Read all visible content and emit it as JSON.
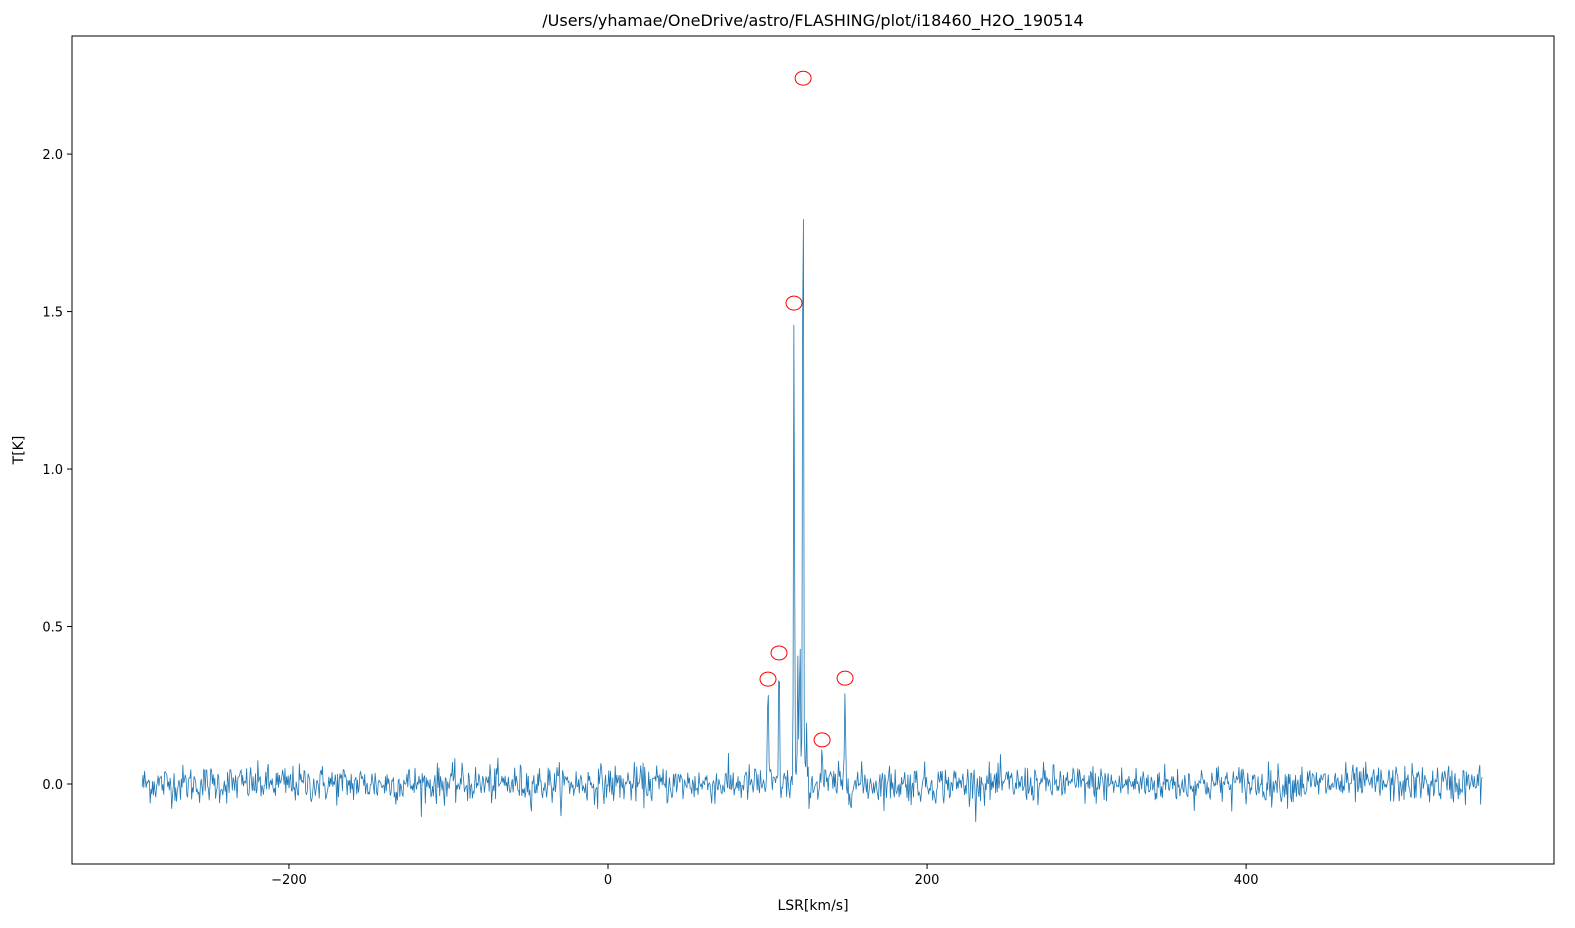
{
  "chart_data": {
    "type": "line",
    "title": "/Users/yhamae/OneDrive/astro/FLASHING/plot/i18460_H2O_190514",
    "xlabel": "LSR[km/s]",
    "ylabel": "T[K]",
    "xlim": [
      -336,
      593
    ],
    "ylim": [
      -0.254,
      2.375
    ],
    "xticks": [
      -200,
      0,
      200,
      400
    ],
    "xtick_labels": [
      "−200",
      "0",
      "200",
      "400"
    ],
    "yticks": [
      0.0,
      0.5,
      1.0,
      1.5,
      2.0
    ],
    "ytick_labels": [
      "0.0",
      "0.5",
      "1.0",
      "1.5",
      "2.0"
    ],
    "grid": false,
    "line_color": "#1f77b4",
    "marker_color": "#ff0000",
    "spectrum": {
      "x_range": [
        -292,
        548
      ],
      "channel_width": 0.5,
      "noise_rms": 0.03,
      "baseline": 0.0,
      "lines": [
        {
          "x": 100.3,
          "y": 0.333
        },
        {
          "x": 107.2,
          "y": 0.416
        },
        {
          "x": 116.6,
          "y": 1.527
        },
        {
          "x": 119.0,
          "y": 0.37
        },
        {
          "x": 120.3,
          "y": 0.5
        },
        {
          "x": 122.3,
          "y": 2.241
        },
        {
          "x": 124.5,
          "y": 0.16
        },
        {
          "x": 134.2,
          "y": 0.14
        },
        {
          "x": 148.6,
          "y": 0.336
        }
      ]
    },
    "detected_peaks": [
      {
        "x": 100.3,
        "y": 0.333
      },
      {
        "x": 107.2,
        "y": 0.416
      },
      {
        "x": 116.6,
        "y": 1.527
      },
      {
        "x": 122.3,
        "y": 2.241
      },
      {
        "x": 134.2,
        "y": 0.14
      },
      {
        "x": 148.6,
        "y": 0.336
      }
    ]
  }
}
